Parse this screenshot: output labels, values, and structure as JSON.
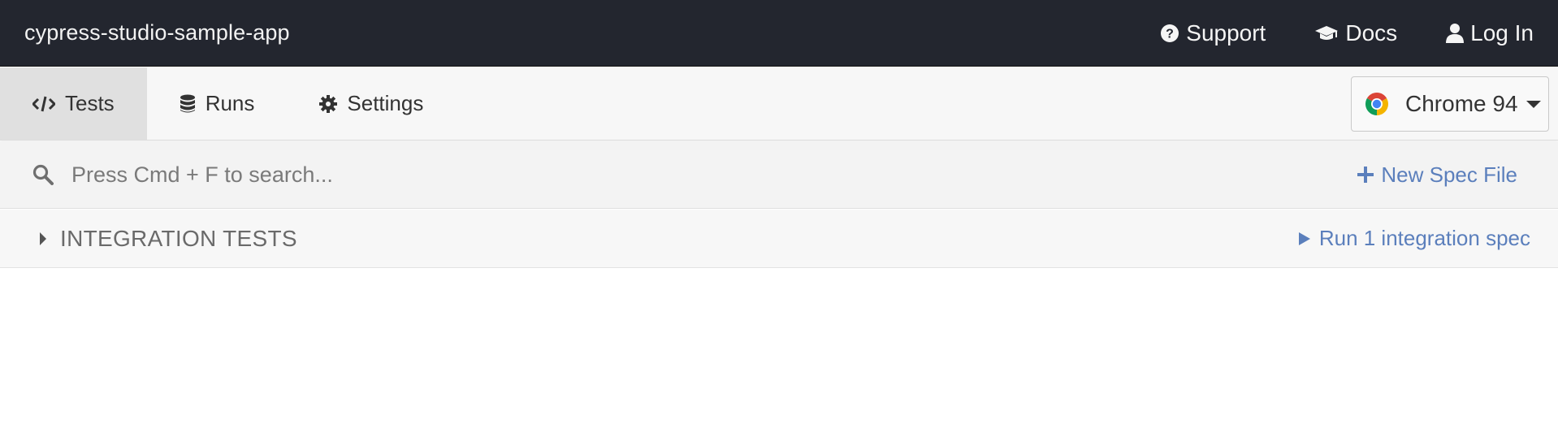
{
  "header": {
    "app_title": "cypress-studio-sample-app",
    "links": [
      {
        "label": "Support",
        "icon": "question-circle-icon"
      },
      {
        "label": "Docs",
        "icon": "graduation-cap-icon"
      },
      {
        "label": "Log In",
        "icon": "user-icon"
      }
    ]
  },
  "nav": {
    "tabs": [
      {
        "label": "Tests",
        "icon": "code-icon",
        "active": true
      },
      {
        "label": "Runs",
        "icon": "database-icon",
        "active": false
      },
      {
        "label": "Settings",
        "icon": "gear-icon",
        "active": false
      }
    ],
    "browser": {
      "label": "Chrome 94",
      "icon": "chrome-logo-icon"
    }
  },
  "search": {
    "placeholder": "Press Cmd + F to search...",
    "value": "",
    "new_spec_label": "New Spec File"
  },
  "specs": {
    "folder_label": "INTEGRATION TESTS",
    "run_label": "Run 1 integration spec"
  },
  "colors": {
    "header_bg": "#23262f",
    "link_blue": "#5b7fbc",
    "active_tab_bg": "#e0e0e0"
  }
}
